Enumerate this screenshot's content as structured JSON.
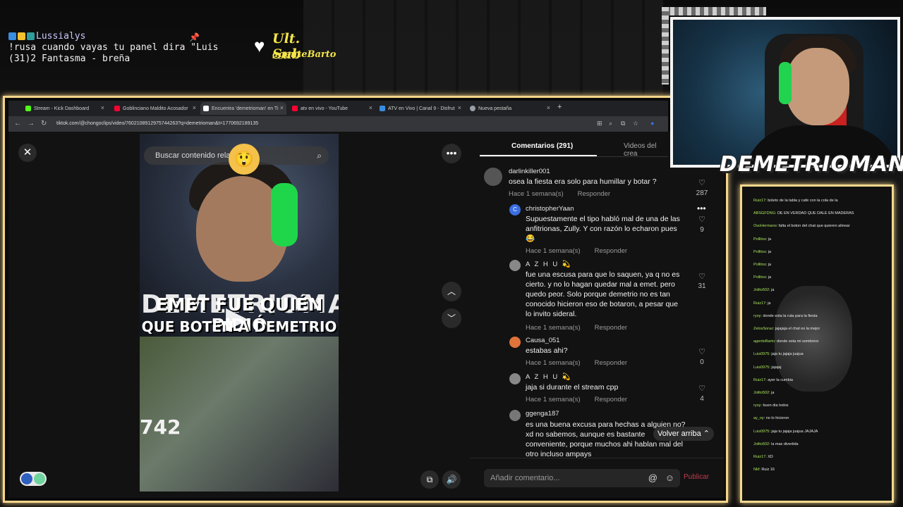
{
  "overlay": {
    "ticker_user": "Lussialys",
    "ticker_line1": "!rusa cuando vayas tu panel dira \"Luis",
    "ticker_line2": "(31)2 Fantasma - breña",
    "sub_title": "Ult. Sub",
    "sub_name": "agenteBarto",
    "cam_name": "DEMETRIOMAN"
  },
  "browser": {
    "tabs": [
      {
        "label": "Stream - Kick Dashboard",
        "color": "#53fc18"
      },
      {
        "label": "Goblinciano Maldito Acosador",
        "color": "#ff0033"
      },
      {
        "label": "Encuentra 'demetrioman' en Ti",
        "color": "#ffffff"
      },
      {
        "label": "atv en vivo - YouTube",
        "color": "#ff0033"
      },
      {
        "label": "ATV en Vivo | Canal 9 - Disfrut",
        "color": "#3a8dde"
      },
      {
        "label": "Nueva pestaña",
        "color": "#9aa0a6"
      }
    ],
    "url": "tiktok.com/@chongoclips/video/7602108912975744263?q=demetrioman&t=1770692189135"
  },
  "video": {
    "search_placeholder": "Buscar contenido relacionado",
    "watermark": "DEMETRIOMAN",
    "overlay_line1": "EMET FUE QUIÉN PIDIÓ",
    "overlay_line2": "QUE BOTEN A DEMETRIO",
    "number": "742"
  },
  "comments": {
    "tab_comments": "Comentarios (291)",
    "tab_videos": "Videos del crea",
    "items": [
      {
        "user": "darlinkiller001",
        "text": "osea la fiesta era solo para humillar y botar ?",
        "time": "Hace 1 semana(s)",
        "reply": "Responder",
        "likes": "287"
      },
      {
        "user": "christopherYaan",
        "text1": "Supuestamente el tipo habló mal de una de las",
        "text2": "anfitrionas, Zully. Y con razón lo echaron pues",
        "text3": "😂",
        "time": "Hace 1 semana(s)",
        "reply": "Responder",
        "likes": "9"
      },
      {
        "user": "A Z H U 💫",
        "text1": "fue una escusa para que lo saquen, ya q no es",
        "text2": "cierto. y no lo hagan quedar mal a emet. pero",
        "text3": "quedo peor. Solo porque demetrio no es tan",
        "text4": "conocido hicieron eso de botaron, a pesar que",
        "text5": "lo invito sideral.",
        "time": "Hace 1 semana(s)",
        "reply": "Responder",
        "likes": "31"
      },
      {
        "user": "Causa_051",
        "text": "estabas ahi?",
        "time": "Hace 1 semana(s)",
        "reply": "Responder",
        "likes": "0"
      },
      {
        "user": "A Z H U 💫",
        "text": "jaja si durante el stream cpp",
        "time": "Hace 1 semana(s)",
        "reply": "Responder",
        "likes": "4"
      },
      {
        "user": "ggenga187",
        "text1": "es una buena excusa para hechas a alguien no?",
        "text2": "xd no sabemos, aunque es bastante",
        "text3": "conveniente, porque muchos ahi hablan mal del",
        "text4": "otro incluso ampays"
      }
    ],
    "back_to_top": "Volver arriba",
    "add_placeholder": "Añadir comentario...",
    "publish": "Publicar"
  },
  "chat": {
    "lines": [
      {
        "name": "Ruiz17",
        "msg": "boleto de la tabla y cafe con la cola de la"
      },
      {
        "name": "ABSGFDNG",
        "msg": "DE EN VERDAD QUE DALE EN MADERAS"
      },
      {
        "name": "OsoHermano",
        "msg": "falta el boton del chat que quieren alinear"
      },
      {
        "name": "Pollitos",
        "msg": "ja"
      },
      {
        "name": "Pollitos",
        "msg": "ja"
      },
      {
        "name": "Pollitos",
        "msg": "ja"
      },
      {
        "name": "Pollitos",
        "msg": "ja"
      },
      {
        "name": "Jolito502",
        "msg": "ja"
      },
      {
        "name": "Ruiz17",
        "msg": "ja"
      },
      {
        "name": "ryoy",
        "msg": "donde esta la ruta para la fiesta"
      },
      {
        "name": "ZelosSoraz",
        "msg": "jajajaja el chat es la mejor"
      },
      {
        "name": "agenteBarto",
        "msg": "donde esta mi sombrero"
      },
      {
        "name": "Luis0975",
        "msg": "jaja tu jajaja juajua"
      },
      {
        "name": "Luis0975",
        "msg": "jajajaj"
      },
      {
        "name": "Ruiz17",
        "msg": "ayer la cumbia"
      },
      {
        "name": "Jolito502",
        "msg": "ja"
      },
      {
        "name": "ryoy",
        "msg": "buen dia todos"
      },
      {
        "name": "ay_oy",
        "msg": "no lo hicieron"
      },
      {
        "name": "Luis0975",
        "msg": "jaja tu jajaja juajua JAJAJA"
      },
      {
        "name": "Jolito502",
        "msg": "la mas divertida"
      },
      {
        "name": "Ruiz17",
        "msg": "XD"
      },
      {
        "name": "Nkf",
        "msg": "Ruiz 16"
      }
    ]
  }
}
